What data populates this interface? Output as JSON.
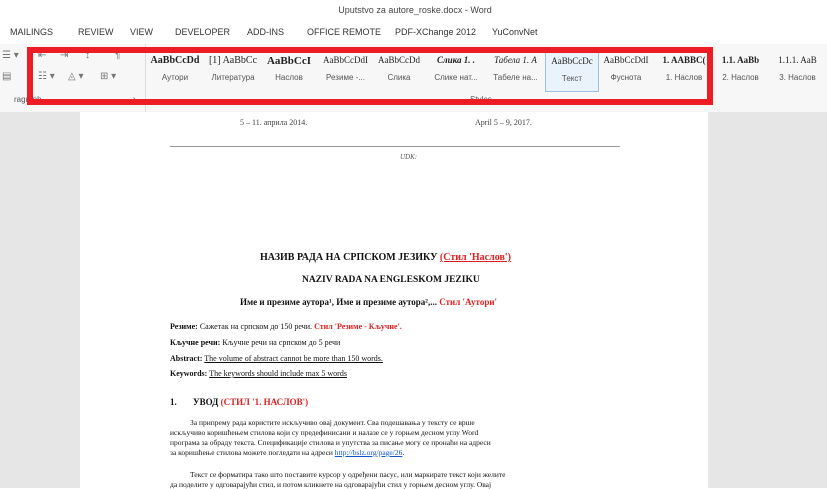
{
  "window": {
    "title": "Uputstvo za autore_roske.docx - Word"
  },
  "menu": [
    "MAILINGS",
    "REVIEW",
    "VIEW",
    "DEVELOPER",
    "ADD-INS",
    "OFFICE REMOTE",
    "PDF-XChange 2012",
    "YuConvNet"
  ],
  "paragraph_group": {
    "label": "ragraph",
    "launcher": "↘"
  },
  "styles_group": {
    "label": "Styles"
  },
  "styles": [
    {
      "preview": "AaBbCcDd",
      "name": "Аутори"
    },
    {
      "preview": "[1] AaBbCc",
      "name": "Литература"
    },
    {
      "preview": "AaBbCcI",
      "name": "Наслов"
    },
    {
      "preview": "AaBbCcDdI",
      "name": "Резиме -..."
    },
    {
      "preview": "AaBbCcDd",
      "name": "Слика"
    },
    {
      "preview": "Слика 1. .",
      "name": "Слике нат..."
    },
    {
      "preview": "Табела 1. А",
      "name": "Табеле на..."
    },
    {
      "preview": "AaBbCcDc",
      "name": "Текст"
    },
    {
      "preview": "AaBbCcDdI",
      "name": "Фуснота"
    },
    {
      "preview": "1. AABBC(",
      "name": "1. Наслов"
    },
    {
      "preview": "1.1. AaBb",
      "name": "2. Наслов"
    },
    {
      "preview": "1.1.1. AaB",
      "name": "3. Наслов"
    }
  ],
  "document": {
    "top_left": "5 – 11. априла 2014.",
    "top_right": "April 5 – 9, 2017.",
    "udk": "UDK:",
    "title_sr": "НАЗИВ РАДА НА СРПСКОМ ЈЕЗИКУ",
    "title_sr_style": "(Стил 'Наслов')",
    "title_en": "NAZIV RADA NA ENGLESKOM JEZIKU",
    "authors": "Име и презиме аутора¹, Име и презиме аутора²,...",
    "authors_style": "Стил 'Аутори'",
    "rezime_label": "Резиме:",
    "rezime_text": "Сажетак на српском до 150 речи.",
    "rezime_style": "Стил 'Резиме - Кључне'.",
    "kljucne_label": "Кључне речи:",
    "kljucne_text": "Кључне речи на српском до 5 речи",
    "abstract_label": "Abstract:",
    "abstract_text": "The volume of abstract cannot be more than 150 words.",
    "keywords_label": "Keywords:",
    "keywords_text": "The keywords should include max 5 words",
    "section_num": "1.",
    "section_title": "УВОД",
    "section_style": "(СТИЛ '1. НАСЛОВ')",
    "para1_lines": [
      "За припрему рада користите искључиво овај документ. Сва подешавања у тексту се врше",
      "искључиво коришћењем стилова који су предефинисани и налазе се у горњем десном углу Word",
      "програма за обраду текста. Спецификације стилова и упутства за писање могу се пронаћи на адреси",
      "за коришћење стилова можете погледати на адреси"
    ],
    "link": "http://bslz.org/page/26",
    "para2_lines": [
      "Текст се форматира тако што поставите курсор у одређени пасус, или маркирате текст који желите",
      "да поделите у одговарајући стил, и потом кликнете на одговарајући стил у горњем десном углу. Овај"
    ]
  }
}
